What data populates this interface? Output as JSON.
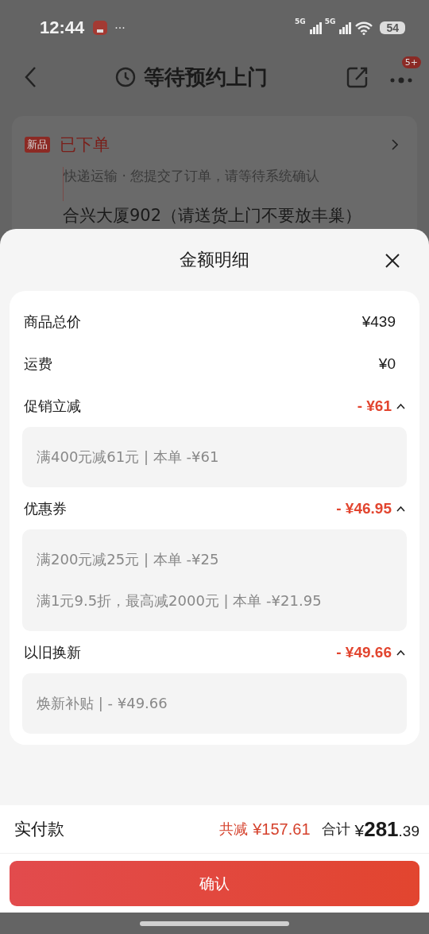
{
  "status_bar": {
    "time": "12:44",
    "more": "···",
    "signals": [
      "5G",
      "5G"
    ],
    "battery": "54"
  },
  "header": {
    "title": "等待预约上门",
    "badge": "5+"
  },
  "order_card": {
    "tag": "新品",
    "status": "已下单",
    "description": "快递运输 · 您提交了订单，请等待系统确认",
    "address": "合兴大厦902（请送货上门不要放丰巢）"
  },
  "sheet": {
    "title": "金额明细",
    "items": [
      {
        "kind": "plain",
        "label": "商品总价",
        "amount": "¥439"
      },
      {
        "kind": "plain",
        "label": "运费",
        "amount": "¥0"
      },
      {
        "kind": "discount",
        "label": "促销立减",
        "amount": "- ¥61",
        "expanded": true,
        "details": [
          "满400元减61元 | 本单 -¥61"
        ]
      },
      {
        "kind": "discount",
        "label": "优惠券",
        "amount": "- ¥46.95",
        "expanded": true,
        "details": [
          "满200元减25元 | 本单 -¥25",
          "满1元9.5折，最高减2000元 | 本单 -¥21.95"
        ]
      },
      {
        "kind": "discount",
        "label": "以旧换新",
        "amount": "- ¥49.66",
        "expanded": true,
        "details": [
          "焕新补贴 | - ¥49.66"
        ]
      }
    ]
  },
  "footer": {
    "label": "实付款",
    "saved_label": "共减",
    "saved": "¥157.61",
    "total_label": "合计",
    "total_symbol": "¥",
    "total_int": "281",
    "total_dec": ".39"
  },
  "confirm_button": "确认"
}
